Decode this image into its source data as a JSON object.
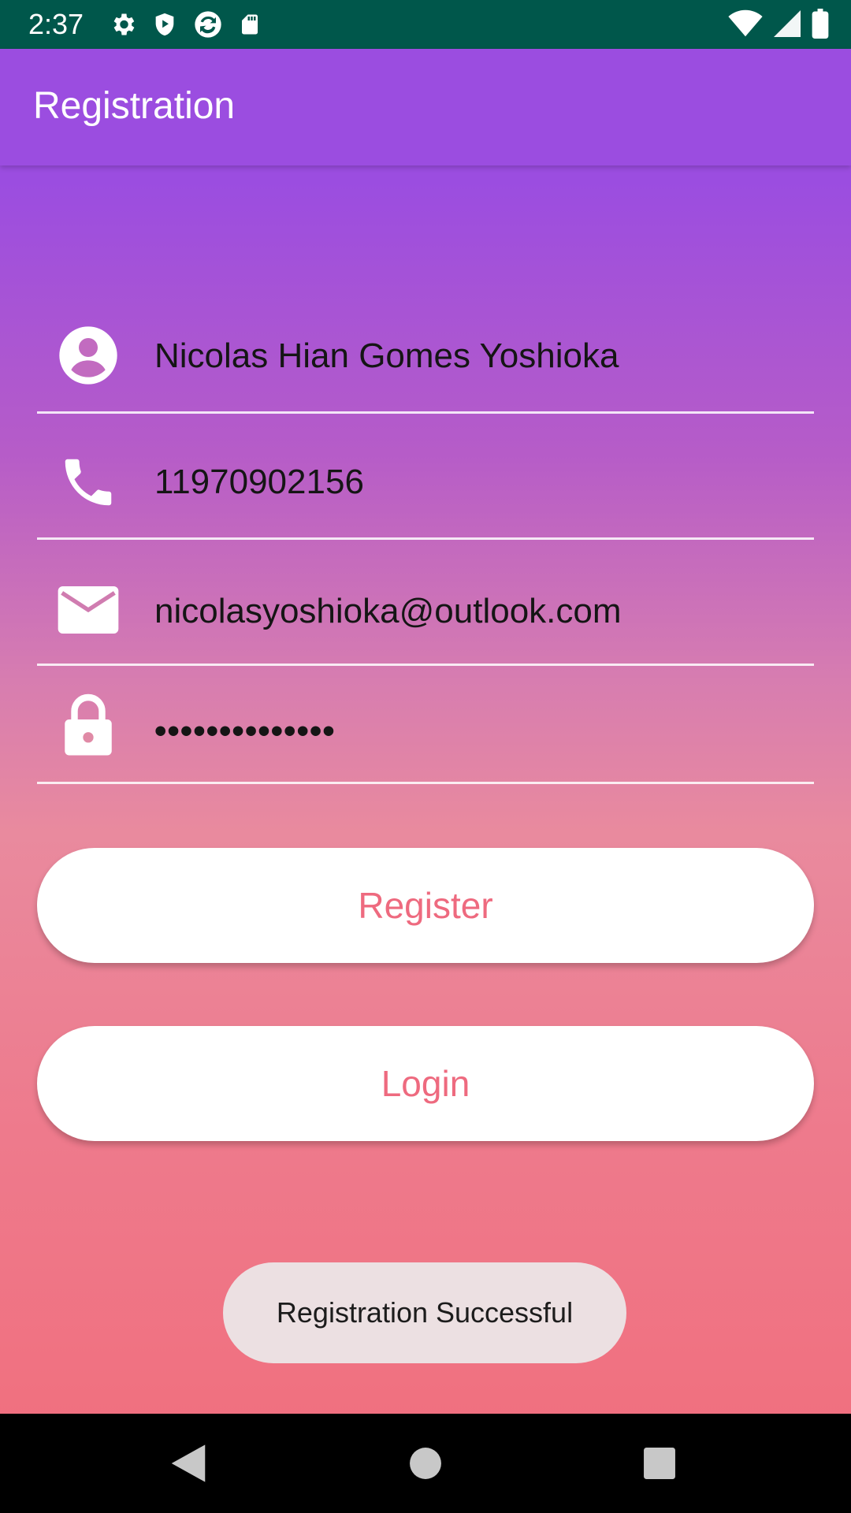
{
  "status_bar": {
    "time": "2:37",
    "left_icons": [
      "settings-gear-icon",
      "shield-play-icon",
      "sync-icon",
      "sd-card-icon"
    ],
    "right_icons": [
      "wifi-icon",
      "cell-signal-icon",
      "battery-icon"
    ]
  },
  "app_bar": {
    "title": "Registration"
  },
  "form": {
    "name": {
      "value": "Nicolas Hian Gomes Yoshioka",
      "icon": "account-circle-icon"
    },
    "phone": {
      "value": "11970902156",
      "icon": "phone-icon"
    },
    "email": {
      "value": "nicolasyoshioka@outlook.com",
      "icon": "email-icon"
    },
    "password": {
      "value": "••••••••••••••",
      "icon": "lock-icon"
    }
  },
  "buttons": {
    "register": "Register",
    "login": "Login"
  },
  "toast": {
    "message": "Registration Successful"
  },
  "nav_bar": {
    "icons": [
      "back-icon",
      "home-icon",
      "recents-icon"
    ]
  },
  "colors": {
    "status_bar": "#00574b",
    "app_bar": "#9b4de0",
    "button_text": "#ee6a7f",
    "gradient_top": "#9b4de0",
    "gradient_bottom": "#f16d7b"
  }
}
